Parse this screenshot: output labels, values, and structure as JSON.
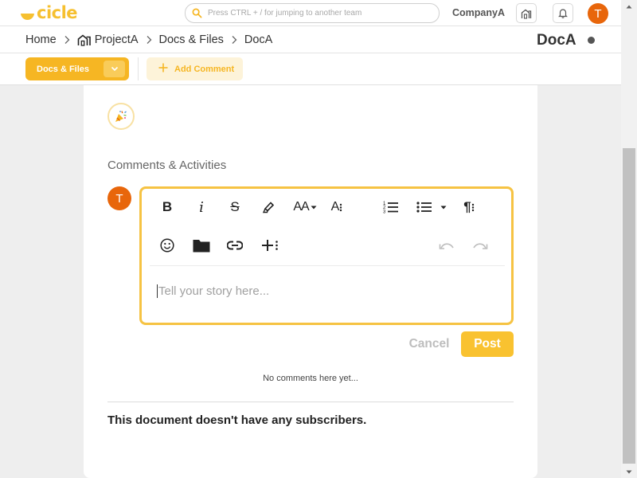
{
  "app": {
    "logo_text": "cicle",
    "brand_color": "#f6c030",
    "accent_orange": "#e8660b"
  },
  "header": {
    "search_placeholder": "Press CTRL + / for jumping to another team",
    "company_name": "CompanyA",
    "icons": [
      "search-icon",
      "company-icon",
      "bell-icon"
    ],
    "user_initial": "T"
  },
  "breadcrumb": {
    "items": [
      "Home",
      "ProjectA",
      "Docs & Files",
      "DocA"
    ],
    "project_icon": "house-icon"
  },
  "document": {
    "title": "DocA"
  },
  "actions": {
    "docs_files_label": "Docs & Files",
    "add_comment_label": "Add Comment"
  },
  "comments": {
    "section_title": "Comments & Activities",
    "user_initial": "T",
    "editor_placeholder": "Tell your story here...",
    "toolbar_icons": [
      "bold-icon",
      "italic-icon",
      "strikethrough-icon",
      "highlight-icon",
      "font-size-icon",
      "font-style-icon",
      "ordered-list-icon",
      "bullet-list-icon",
      "paragraph-icon",
      "emoji-icon",
      "folder-icon",
      "link-icon",
      "insert-more-icon",
      "undo-icon",
      "redo-icon"
    ],
    "toolbar_labels": {
      "bold": "B",
      "italic": "i",
      "strike": "S",
      "font_size": "AA",
      "font_style": "A",
      "paragraph": "¶"
    },
    "cancel_label": "Cancel",
    "post_label": "Post",
    "empty_text": "No comments here yet...",
    "subscribers_text": "This document doesn't have any subscribers."
  }
}
